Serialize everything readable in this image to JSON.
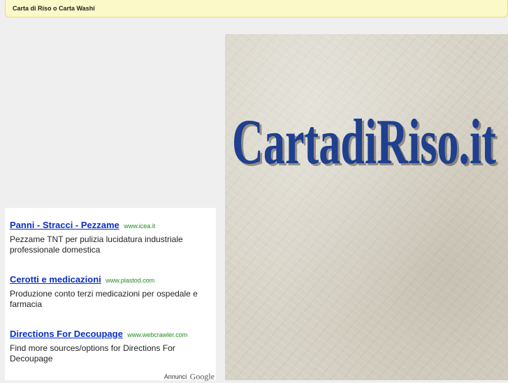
{
  "topbar": {
    "title": "Carta di Riso o Carta Washi"
  },
  "hero": {
    "logo_text": "CartadiRiso.it",
    "logo_color": "#1f3f8f"
  },
  "ads": {
    "items": [
      {
        "title": "Panni - Stracci - Pezzame",
        "url": "www.icea.it",
        "description": "Pezzame TNT per pulizia lucidatura industriale professionale domestica"
      },
      {
        "title": "Cerotti e medicazioni",
        "url": "www.plastod.com",
        "description": "Produzione conto terzi medicazioni per ospedale e farmacia"
      },
      {
        "title": "Directions For Decoupage",
        "url": "www.webcrawler.com",
        "description": "Find more sources/options for Directions For Decoupage"
      }
    ],
    "annunci_label": "Annunci",
    "google_label": "Google"
  }
}
